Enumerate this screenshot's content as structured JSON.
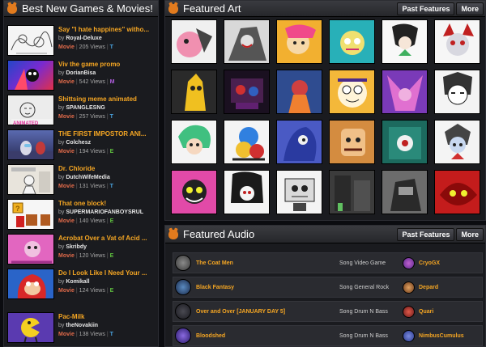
{
  "left_panel": {
    "title": "Best New Games & Movies!",
    "items": [
      {
        "title": "Say \"I hate happines\" witho...",
        "by": "by",
        "author": "Royal-Deluxe",
        "type": "Movie",
        "views": "205 Views",
        "rating": "T"
      },
      {
        "title": "Viv the game promo",
        "by": "by",
        "author": "DorianBisa",
        "type": "Movie",
        "views": "542 Views",
        "rating": "M"
      },
      {
        "title": "Shittsing meme animated",
        "by": "by",
        "author": "SPANGLESNG",
        "type": "Movie",
        "views": "257 Views",
        "rating": "T"
      },
      {
        "title": "THE FIRST IMPOSTOR ANI...",
        "by": "by",
        "author": "Colchesz",
        "type": "Movie",
        "views": "194 Views",
        "rating": "E"
      },
      {
        "title": "Dr. Chloride",
        "by": "by",
        "author": "DutchWifeMedia",
        "type": "Movie",
        "views": "131 Views",
        "rating": "T"
      },
      {
        "title": "That one block!",
        "by": "by",
        "author": "SUPERMARIOFANBOYSRUL",
        "type": "Movie",
        "views": "140 Views",
        "rating": "E"
      },
      {
        "title": "Acrobat Over a Vat of Acid ...",
        "by": "by",
        "author": "Skribdy",
        "type": "Movie",
        "views": "120 Views",
        "rating": "E"
      },
      {
        "title": "Do I Look Like I Need Your ...",
        "by": "by",
        "author": "Komikall",
        "type": "Movie",
        "views": "124 Views",
        "rating": "E"
      },
      {
        "title": "Pac-Milk",
        "by": "by",
        "author": "theNovakiin",
        "type": "Movie",
        "views": "138 Views",
        "rating": "T"
      }
    ]
  },
  "art_panel": {
    "title": "Featured Art",
    "past_label": "Past Features",
    "more_label": "More"
  },
  "audio_panel": {
    "title": "Featured Audio",
    "past_label": "Past Features",
    "more_label": "More",
    "tracks": [
      {
        "title": "The Coat Men",
        "genre": "Song Video Game",
        "author": "CryoGX"
      },
      {
        "title": "Black Fantasy",
        "genre": "Song General Rock",
        "author": "Depard"
      },
      {
        "title": "Over and Over [JANUARY DAY 5]",
        "genre": "Song Drum N Bass",
        "author": "Quari"
      },
      {
        "title": "Bloodshed",
        "genre": "Song Drum N Bass",
        "author": "NimbusCumulus"
      }
    ]
  },
  "colors": {
    "accent_orange": "#f5a623",
    "brand_orange": "#e27b1e",
    "movie_label": "#e06a4a",
    "rating_t": "#4aa3df",
    "rating_e": "#5fbf3f",
    "rating_m": "#b15fe0"
  }
}
